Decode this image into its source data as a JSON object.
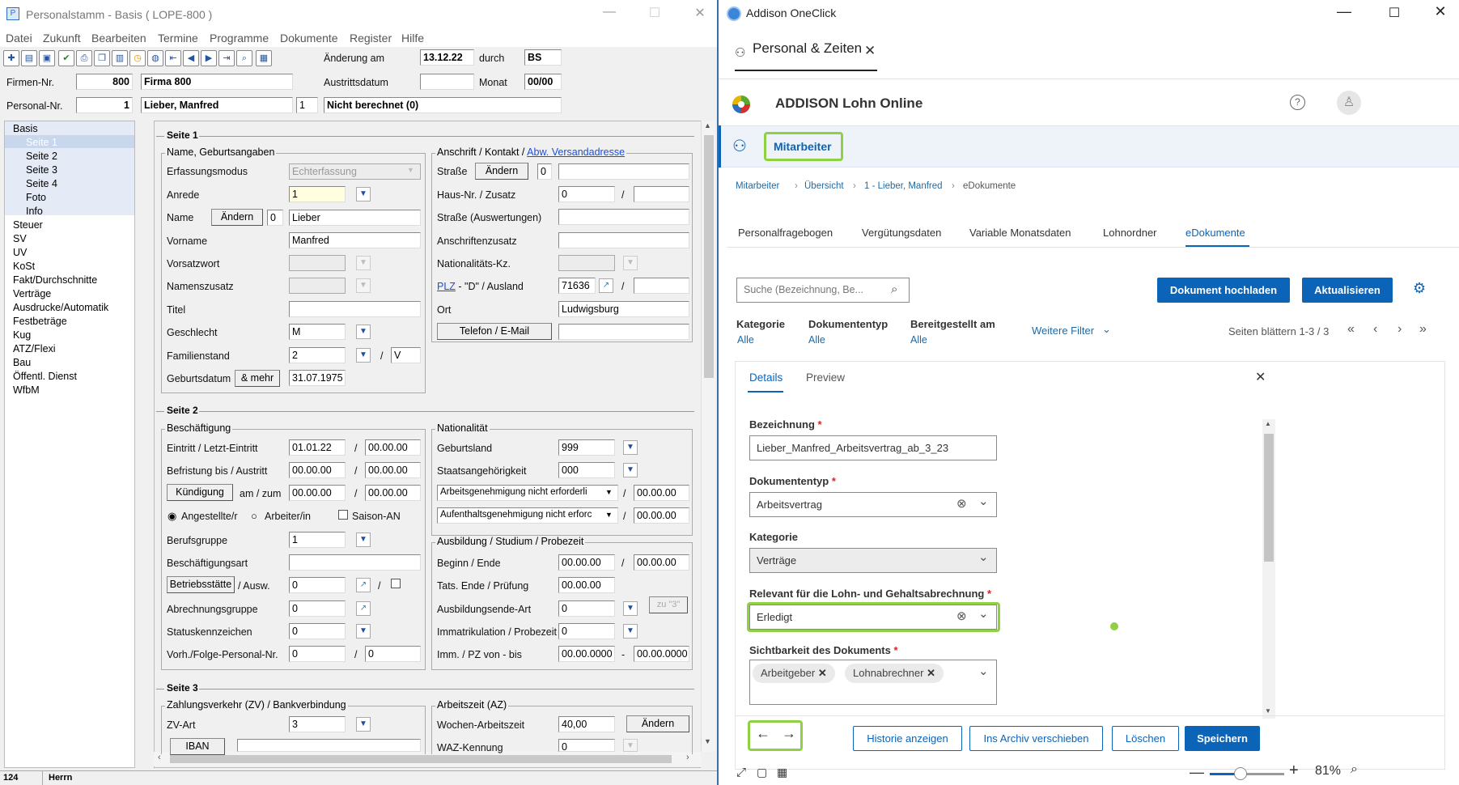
{
  "left": {
    "title": "Personalstamm - Basis  ( LOPE-800 )",
    "menu": [
      "Datei",
      "Zukunft",
      "Bearbeiten",
      "Termine",
      "Programme",
      "Dokumente",
      "Register",
      "Hilfe"
    ],
    "header": {
      "aenderung_label": "Änderung am",
      "aenderung_value": "13.12.22",
      "durch_label": "durch",
      "durch_value": "BS",
      "austritt_label": "Austrittsdatum",
      "austritt_value": "",
      "monat_label": "Monat",
      "monat_value": "00/00",
      "firmen_label": "Firmen-Nr.",
      "firmen_nr": "800",
      "firmen_name": "Firma 800",
      "personal_label": "Personal-Nr.",
      "personal_nr": "1",
      "personal_name": "Lieber, Manfred",
      "personal_extra": "1",
      "berechnet": "Nicht berechnet (0)"
    },
    "tree": {
      "basis": "Basis",
      "seiten": [
        "Seite 1",
        "Seite 2",
        "Seite 3",
        "Seite 4",
        "Foto",
        "Info"
      ],
      "items": [
        "Steuer",
        "SV",
        "UV",
        "KoSt",
        "Fakt/Durchschnitte",
        "Verträge",
        "Ausdrucke/Automatik",
        "Festbeträge",
        "Kug",
        "ATZ/Flexi",
        "Bau",
        "Öffentl. Dienst",
        "WfbM"
      ]
    },
    "s1": {
      "title": "Seite 1",
      "grp_name": "Name, Geburtsangaben",
      "erfassungsmodus_l": "Erfassungsmodus",
      "erfassungsmodus_v": "Echterfassung",
      "anrede_l": "Anrede",
      "anrede_v": "1",
      "name_l": "Name",
      "aendern": "Ändern",
      "name_n": "0",
      "name_v": "Lieber",
      "vorname_l": "Vorname",
      "vorname_v": "Manfred",
      "vorsatz_l": "Vorsatzwort",
      "namenszusatz_l": "Namenszusatz",
      "titel_l": "Titel",
      "geschlecht_l": "Geschlecht",
      "geschlecht_v": "M",
      "familienstand_l": "Familienstand",
      "familienstand_v": "2",
      "familienstand_v2": "V",
      "geburtsdatum_l": "Geburtsdatum",
      "mehr": "& mehr",
      "geburtsdatum_v": "31.07.1975",
      "grp_anschrift": "Anschrift / Kontakt / ",
      "abw": "Abw. Versandadresse",
      "strasse_l": "Straße",
      "strasse_n": "0",
      "hausnr_l": "Haus-Nr. / Zusatz",
      "hausnr_v": "0",
      "strasse_ausw_l": "Straße (Auswertungen)",
      "anschriftenzusatz_l": "Anschriftenzusatz",
      "nationalitaet_l": "Nationalitäts-Kz.",
      "plz_link": "PLZ",
      "plz_rest": " - \"D\" / Ausland",
      "plz_v": "71636",
      "ort_l": "Ort",
      "ort_v": "Ludwigsburg",
      "telefon_btn": "Telefon / E-Mail"
    },
    "s2": {
      "title": "Seite 2",
      "grp_besch": "Beschäftigung",
      "eintritt_l": "Eintritt / Letzt-Eintritt",
      "eintritt_v": "01.01.22",
      "eintritt_v2": "00.00.00",
      "befristung_l": "Befristung bis / Austritt",
      "befristung_v": "00.00.00",
      "befristung_v2": "00.00.00",
      "kuendigung": "Kündigung",
      "amzum": "am / zum",
      "kuend_v": "00.00.00",
      "kuend_v2": "00.00.00",
      "angestellte": "Angestellte/r",
      "arbeiter": "Arbeiter/in",
      "saison": "Saison-AN",
      "berufsgruppe_l": "Berufsgruppe",
      "berufsgruppe_v": "1",
      "beschart_l": "Beschäftigungsart",
      "betriebsstaette": "Betriebsstätte",
      "ausw": "/ Ausw.",
      "betrieb_v": "0",
      "abrechnungsgruppe_l": "Abrechnungsgruppe",
      "abrechnungsgruppe_v": "0",
      "statuskz_l": "Statuskennzeichen",
      "statuskz_v": "0",
      "vorh_l": "Vorh./Folge-Personal-Nr.",
      "vorh_v": "0",
      "vorh_v2": "0",
      "grp_nat": "Nationalität",
      "geburtsland_l": "Geburtsland",
      "geburtsland_v": "999",
      "staatsang_l": "Staatsangehörigkeit",
      "staatsang_v": "000",
      "arbeitsgen_v": "Arbeitsgenehmigung nicht erforderli",
      "arbeitsgen_d": "00.00.00",
      "aufenthalt_v": "Aufenthaltsgenehmigung nicht erforc",
      "aufenthalt_d": "00.00.00",
      "grp_ausb": "Ausbildung / Studium / Probezeit",
      "beginn_l": "Beginn / Ende",
      "beginn_v": "00.00.00",
      "beginn_v2": "00.00.00",
      "tats_l": "Tats. Ende / Prüfung",
      "tats_v": "00.00.00",
      "ausbende_l": "Ausbildungsende-Art",
      "ausbende_v": "0",
      "zu3": "zu \"3\"",
      "immatr_l": "Immatrikulation / Probezeit",
      "immatr_v": "0",
      "imm_l": "Imm. / PZ von - bis",
      "imm_v": "00.00.0000",
      "imm_v2": "00.00.0000"
    },
    "s3": {
      "title": "Seite 3",
      "grp_zv": "Zahlungsverkehr (ZV) / Bankverbindung",
      "zvart_l": "ZV-Art",
      "zvart_v": "3",
      "iban": "IBAN",
      "grp_az": "Arbeitszeit (AZ)",
      "wochen_l": "Wochen-Arbeitszeit",
      "wochen_v": "40,00",
      "aendern": "Ändern",
      "waz_l": "WAZ-Kennung",
      "waz_v": "0"
    },
    "status": {
      "num": "124",
      "text": "Herrn"
    }
  },
  "right": {
    "title": "Addison OneClick",
    "tab": "Personal & Zeiten",
    "app": "ADDISON Lohn Online",
    "section": "Mitarbeiter",
    "breadcrumb": [
      "Mitarbeiter",
      "Übersicht",
      "1 - Lieber, Manfred",
      "eDokumente"
    ],
    "tabs": [
      "Personalfragebogen",
      "Vergütungsdaten",
      "Variable Monatsdaten",
      "Lohnordner",
      "eDokumente"
    ],
    "search_placeholder": "Suche (Bezeichnung, Be...",
    "upload": "Dokument hochladen",
    "refresh": "Aktualisieren",
    "filters": [
      {
        "label": "Kategorie",
        "value": "Alle"
      },
      {
        "label": "Dokumententyp",
        "value": "Alle"
      },
      {
        "label": "Bereitgestellt am",
        "value": "Alle"
      }
    ],
    "more_filters": "Weitere Filter",
    "paging": "Seiten blättern 1-3 / 3",
    "panel_tabs": [
      "Details",
      "Preview"
    ],
    "fields": {
      "bezeichnung_l": "Bezeichnung",
      "bezeichnung_v": "Lieber_Manfred_Arbeitsvertrag_ab_3_23",
      "doktyp_l": "Dokumententyp",
      "doktyp_v": "Arbeitsvertrag",
      "kategorie_l": "Kategorie",
      "kategorie_v": "Verträge",
      "relevant_l": "Relevant für die Lohn- und Gehaltsabrechnung",
      "relevant_v": "Erledigt",
      "sicht_l": "Sichtbarkeit des Dokuments",
      "chips": [
        "Arbeitgeber",
        "Lohnabrechner"
      ]
    },
    "actions": {
      "historie": "Historie anzeigen",
      "archiv": "Ins Archiv verschieben",
      "loeschen": "Löschen",
      "speichern": "Speichern"
    },
    "zoom": "81%",
    "accent": "#0b64b8",
    "highlight": "#8fd142"
  }
}
